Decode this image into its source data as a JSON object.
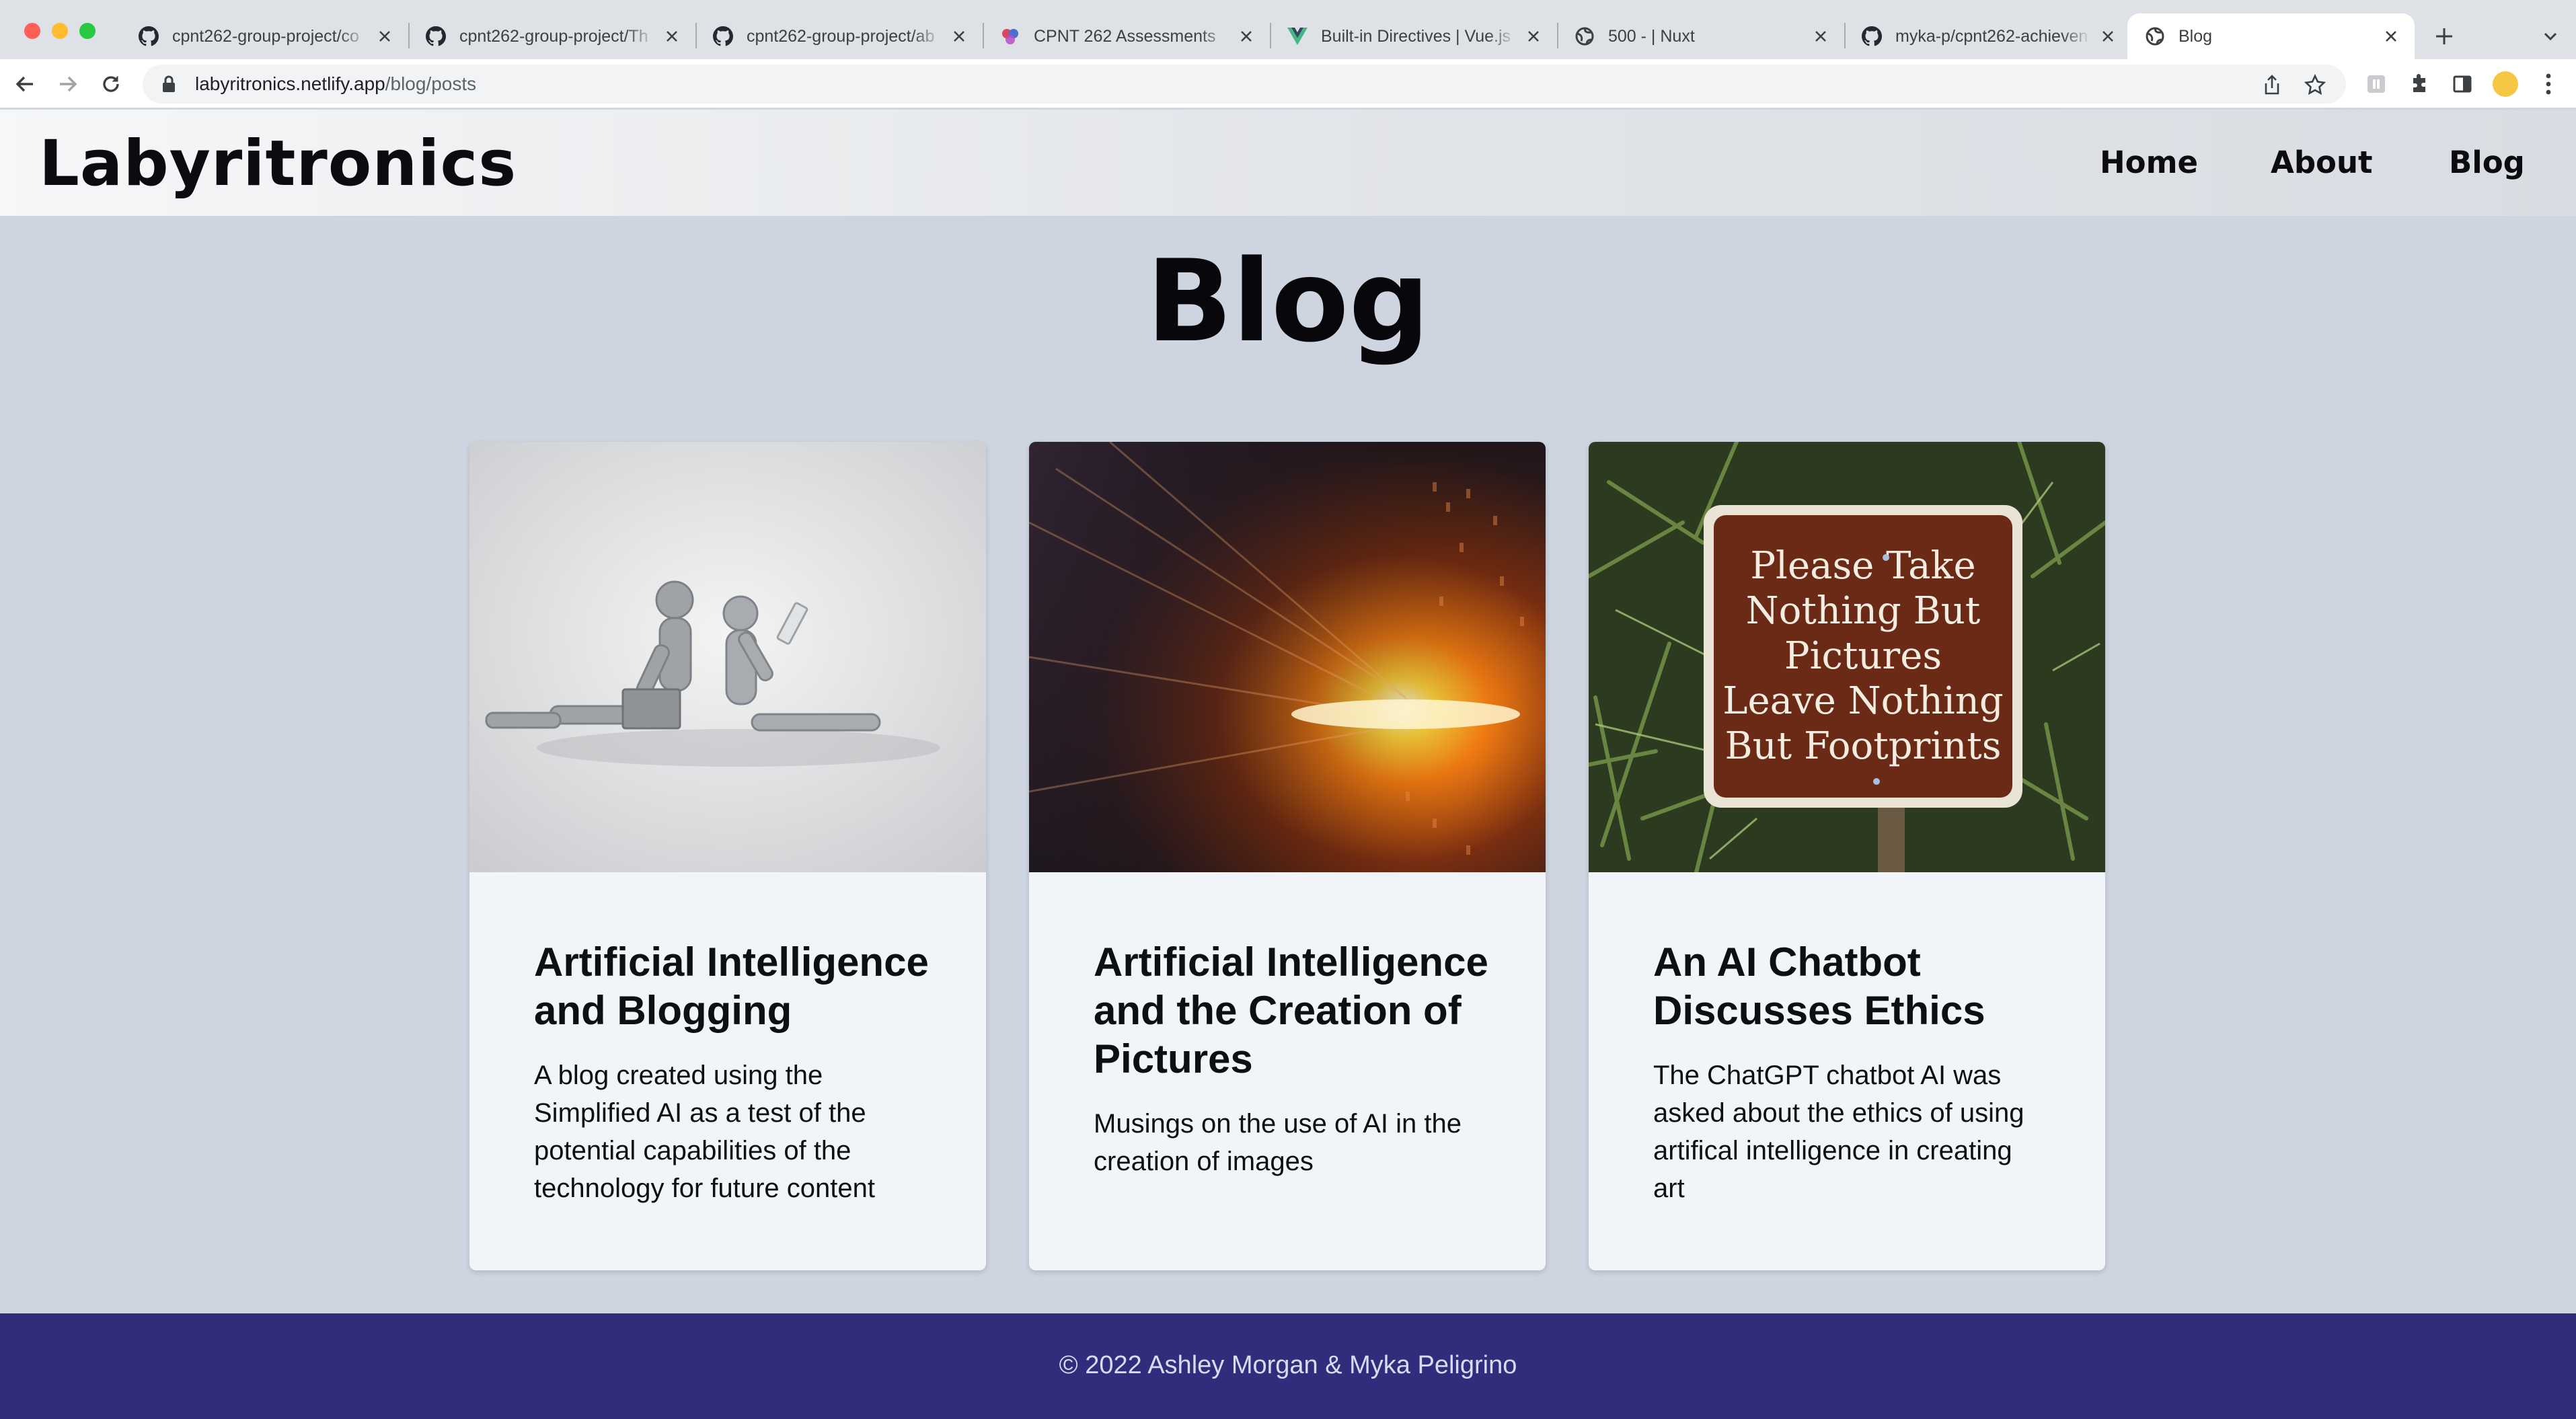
{
  "browser": {
    "tabs": [
      {
        "title": "cpnt262-group-project/co",
        "icon": "github-icon"
      },
      {
        "title": "cpnt262-group-project/Th",
        "icon": "github-icon"
      },
      {
        "title": "cpnt262-group-project/ab",
        "icon": "github-icon"
      },
      {
        "title": "CPNT 262 Assessments",
        "icon": "assessments-icon"
      },
      {
        "title": "Built-in Directives | Vue.js",
        "icon": "vue-icon"
      },
      {
        "title": "500 - | Nuxt",
        "icon": "globe-icon"
      },
      {
        "title": "myka-p/cpnt262-achieven",
        "icon": "github-icon"
      },
      {
        "title": "Blog",
        "icon": "globe-icon"
      }
    ],
    "active_tab": 7,
    "url": {
      "host": "labyritronics.netlify.app",
      "path": "/blog/posts"
    }
  },
  "site": {
    "brand": "Labyritronics",
    "nav": [
      {
        "label": "Home"
      },
      {
        "label": "About"
      },
      {
        "label": "Blog"
      }
    ],
    "page_title": "Blog",
    "posts": [
      {
        "title": "Artificial Intelligence and Blogging",
        "excerpt": "A blog created using the Simplified AI as a test of the potential capabilities of the technology for future content",
        "image": "robot-figurines-with-laptop"
      },
      {
        "title": "Artificial Intelligence and the Creation of Pictures",
        "excerpt": "Musings on the use of AI in the creation of images",
        "image": "glowing-light-burst-through-code"
      },
      {
        "title": "An AI Chatbot Discusses Ethics",
        "excerpt": "The ChatGPT chatbot AI was asked about the ethics of using artifical intelligence in creating art",
        "image": "park-sign",
        "sign_text": [
          "Please Take",
          "Nothing But",
          "Pictures",
          "Leave Nothing",
          "But Footprints"
        ]
      }
    ],
    "footer": "© 2022 Ashley Morgan & Myka Peligrino"
  },
  "colors": {
    "page_bg": "#ced5e0",
    "card_bg": "#f1f4f9",
    "footer_bg": "#312c7c",
    "text": "#0d0f14"
  }
}
